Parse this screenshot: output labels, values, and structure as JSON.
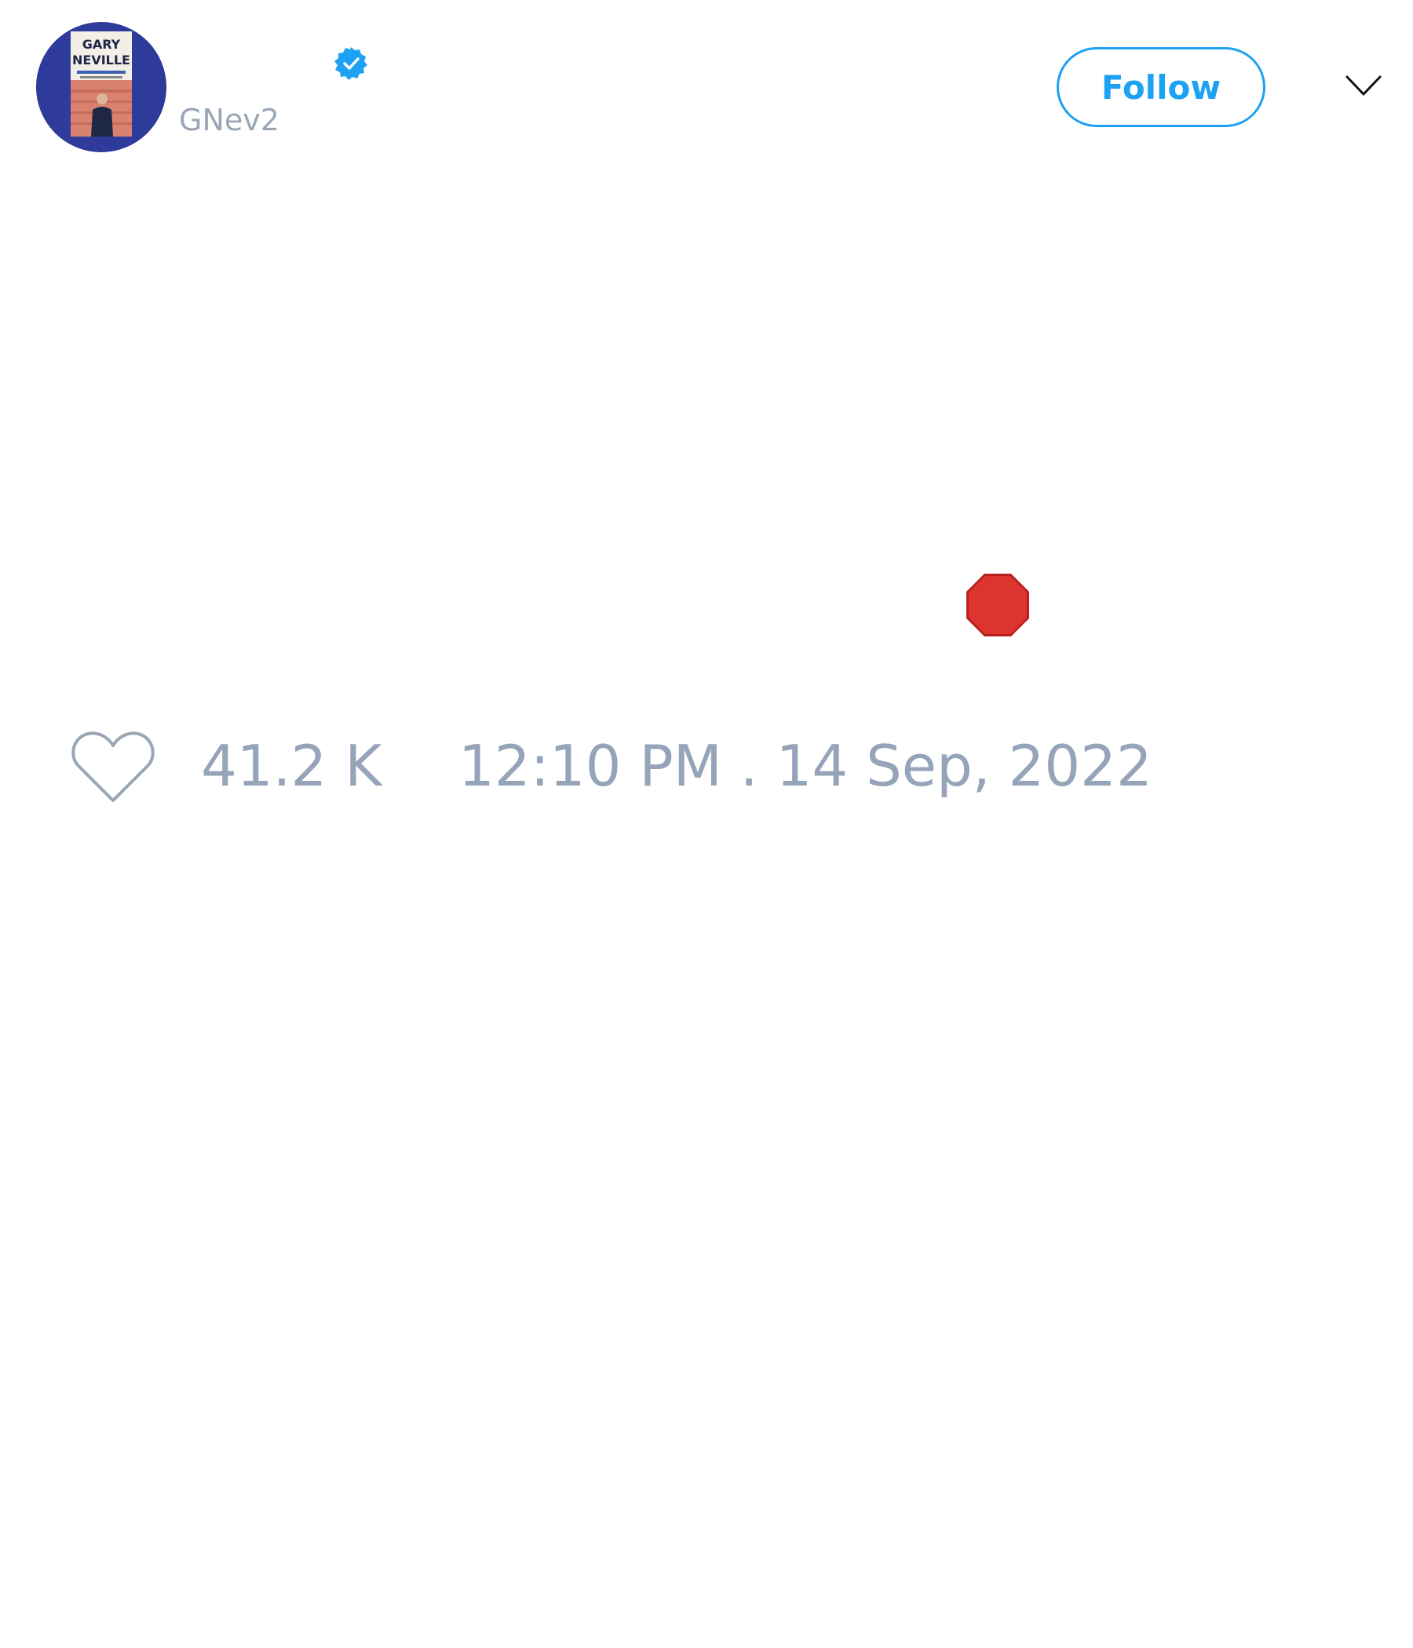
{
  "tweet": {
    "handle": "GNev2",
    "verified": true,
    "avatar_icon": "book-cover-avatar",
    "follow_label": "Follow",
    "menu_icon": "chevron-down-icon",
    "body_emoji": "stop-sign-icon",
    "likes": "41.2 K",
    "timestamp": "12:10 PM . 14 Sep, 2022"
  },
  "colors": {
    "accent": "#1da1f2",
    "muted_text": "#95a4b8",
    "avatar_bg": "#2f3b9a",
    "stop_sign": "#d7302c"
  },
  "avatar_book": {
    "title_line_1": "GARY",
    "title_line_2": "NEVILLE"
  }
}
